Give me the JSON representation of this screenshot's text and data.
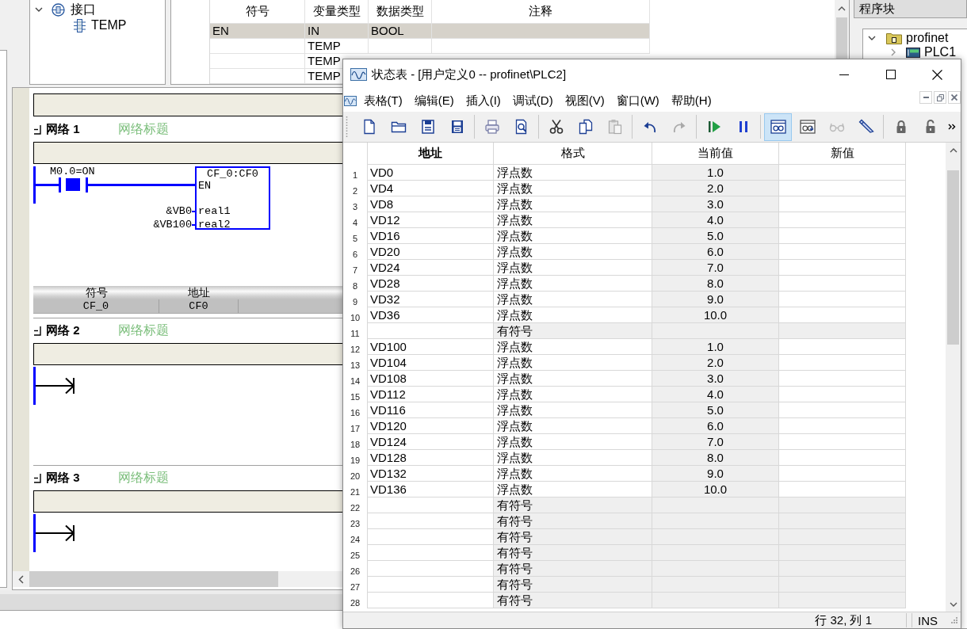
{
  "interface_tree": [
    {
      "label": "接口",
      "expanded": true,
      "children": [
        {
          "label": "TEMP"
        }
      ]
    }
  ],
  "variable_table": {
    "columns": [
      "符号",
      "变量类型",
      "数据类型",
      "注释"
    ],
    "rows": [
      {
        "symbol": "EN",
        "variable_type": "IN",
        "data_type": "BOOL",
        "selected": true
      },
      {
        "variable_type": "TEMP",
        "selected": false
      },
      {
        "variable_type": "TEMP",
        "selected": false
      },
      {
        "variable_type": "TEMP",
        "selected": false
      }
    ]
  },
  "program_blocks": {
    "title": "程序块",
    "tree": [
      {
        "label": "profinet",
        "expanded": true,
        "children": [
          {
            "label": "PLC1",
            "expanded": false
          }
        ]
      }
    ]
  },
  "editor": {
    "networks": [
      {
        "label": "网络 1",
        "title": "网络标题",
        "expanded": true,
        "kind": "contact_block",
        "contact": {
          "label": "M0.0=ON",
          "closed": true
        },
        "block": {
          "name": "CF_0:CF0",
          "enable_pin": "EN",
          "inputs": [
            {
              "pin": "real1",
              "operand": "&VB0"
            },
            {
              "pin": "real2",
              "operand": "&VB100"
            }
          ]
        },
        "symbol_table": {
          "columns": [
            "符号",
            "地址"
          ],
          "rows": [
            [
              "CF_0",
              "CF0"
            ]
          ]
        }
      },
      {
        "label": "网络 2",
        "title": "网络标题",
        "expanded": true,
        "kind": "empty"
      },
      {
        "label": "网络 3",
        "title": "网络标题",
        "expanded": true,
        "kind": "empty"
      }
    ]
  },
  "status_window": {
    "title": "状态表 - [用户定义0 -- profinet\\PLC2]",
    "menu": [
      "表格(T)",
      "编辑(E)",
      "插入(I)",
      "调试(D)",
      "视图(V)",
      "窗口(W)",
      "帮助(H)"
    ],
    "toolbar_groups": [
      {
        "buttons": [
          {
            "kind": "new",
            "disabled": false,
            "selected": false
          },
          {
            "kind": "open",
            "disabled": false,
            "selected": false
          },
          {
            "kind": "save",
            "disabled": false,
            "selected": false
          },
          {
            "kind": "save_all",
            "disabled": false,
            "selected": false
          }
        ]
      },
      {
        "buttons": [
          {
            "kind": "print",
            "disabled": false,
            "selected": false
          },
          {
            "kind": "preview",
            "disabled": false,
            "selected": false
          }
        ]
      },
      {
        "buttons": [
          {
            "kind": "cut",
            "disabled": false,
            "selected": false
          },
          {
            "kind": "copy",
            "disabled": false,
            "selected": false
          },
          {
            "kind": "paste",
            "disabled": true,
            "selected": false
          }
        ]
      },
      {
        "buttons": [
          {
            "kind": "undo",
            "disabled": false,
            "selected": false
          },
          {
            "kind": "redo",
            "disabled": true,
            "selected": false
          }
        ]
      },
      {
        "buttons": [
          {
            "kind": "run",
            "disabled": false,
            "selected": false
          },
          {
            "kind": "pause",
            "disabled": false,
            "selected": false
          }
        ]
      },
      {
        "buttons": [
          {
            "kind": "chart_status",
            "disabled": false,
            "selected": true
          },
          {
            "kind": "single_read",
            "disabled": false,
            "selected": false
          },
          {
            "kind": "watch",
            "disabled": true,
            "selected": false
          },
          {
            "kind": "write",
            "disabled": false,
            "selected": false
          }
        ]
      },
      {
        "buttons": [
          {
            "kind": "force",
            "disabled": false,
            "selected": false
          },
          {
            "kind": "unforce",
            "disabled": false,
            "selected": false
          }
        ]
      }
    ],
    "columns": [
      "地址",
      "格式",
      "当前值",
      "新值"
    ],
    "rows": [
      {
        "number": "1",
        "address": "VD0",
        "format": "浮点数",
        "current_value": "1.0"
      },
      {
        "number": "2",
        "address": "VD4",
        "format": "浮点数",
        "current_value": "2.0"
      },
      {
        "number": "3",
        "address": "VD8",
        "format": "浮点数",
        "current_value": "3.0"
      },
      {
        "number": "4",
        "address": "VD12",
        "format": "浮点数",
        "current_value": "4.0"
      },
      {
        "number": "5",
        "address": "VD16",
        "format": "浮点数",
        "current_value": "5.0"
      },
      {
        "number": "6",
        "address": "VD20",
        "format": "浮点数",
        "current_value": "6.0"
      },
      {
        "number": "7",
        "address": "VD24",
        "format": "浮点数",
        "current_value": "7.0"
      },
      {
        "number": "8",
        "address": "VD28",
        "format": "浮点数",
        "current_value": "8.0"
      },
      {
        "number": "9",
        "address": "VD32",
        "format": "浮点数",
        "current_value": "9.0"
      },
      {
        "number": "10",
        "address": "VD36",
        "format": "浮点数",
        "current_value": "10.0"
      },
      {
        "number": "11",
        "format": "有符号"
      },
      {
        "number": "12",
        "address": "VD100",
        "format": "浮点数",
        "current_value": "1.0"
      },
      {
        "number": "13",
        "address": "VD104",
        "format": "浮点数",
        "current_value": "2.0"
      },
      {
        "number": "14",
        "address": "VD108",
        "format": "浮点数",
        "current_value": "3.0"
      },
      {
        "number": "15",
        "address": "VD112",
        "format": "浮点数",
        "current_value": "4.0"
      },
      {
        "number": "16",
        "address": "VD116",
        "format": "浮点数",
        "current_value": "5.0"
      },
      {
        "number": "17",
        "address": "VD120",
        "format": "浮点数",
        "current_value": "6.0"
      },
      {
        "number": "18",
        "address": "VD124",
        "format": "浮点数",
        "current_value": "7.0"
      },
      {
        "number": "19",
        "address": "VD128",
        "format": "浮点数",
        "current_value": "8.0"
      },
      {
        "number": "20",
        "address": "VD132",
        "format": "浮点数",
        "current_value": "9.0"
      },
      {
        "number": "21",
        "address": "VD136",
        "format": "浮点数",
        "current_value": "10.0"
      },
      {
        "number": "22",
        "format": "有符号"
      },
      {
        "number": "23",
        "format": "有符号"
      },
      {
        "number": "24",
        "format": "有符号"
      },
      {
        "number": "25",
        "format": "有符号"
      },
      {
        "number": "26",
        "format": "有符号"
      },
      {
        "number": "27",
        "format": "有符号"
      },
      {
        "number": "28",
        "format": "有符号"
      }
    ],
    "status_bar": {
      "position": "行 32, 列 1",
      "mode": "INS"
    }
  }
}
